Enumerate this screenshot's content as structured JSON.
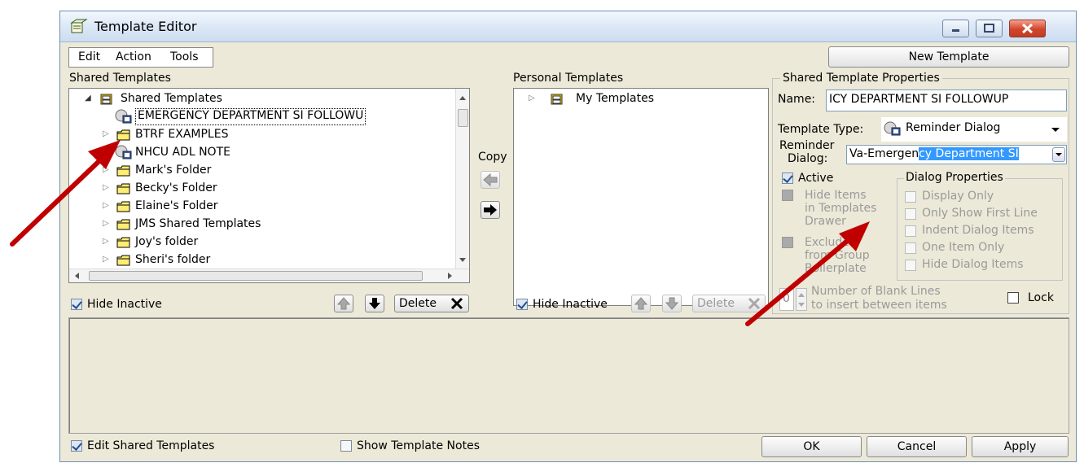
{
  "window": {
    "title": "Template Editor"
  },
  "menu": [
    {
      "label": "Edit"
    },
    {
      "label": "Action"
    },
    {
      "label": "Tools"
    }
  ],
  "new_template_label": "New Template",
  "shared": {
    "panel_label": "Shared Templates",
    "root": "Shared Templates",
    "items": [
      {
        "label": "EMERGENCY DEPARTMENT SI FOLLOWU",
        "kind": "reminder",
        "selected": true
      },
      {
        "label": "BTRF EXAMPLES",
        "kind": "folder"
      },
      {
        "label": "NHCU ADL NOTE",
        "kind": "reminder"
      },
      {
        "label": "Mark's Folder",
        "kind": "folder"
      },
      {
        "label": "Becky's Folder",
        "kind": "folder"
      },
      {
        "label": "Elaine's Folder",
        "kind": "folder"
      },
      {
        "label": "JMS Shared Templates",
        "kind": "folder"
      },
      {
        "label": "Joy's folder",
        "kind": "folder"
      },
      {
        "label": "Sheri's folder",
        "kind": "folder"
      }
    ],
    "hide_inactive_label": "Hide Inactive",
    "hide_inactive_checked": true,
    "delete_label": "Delete"
  },
  "copy_label": "Copy",
  "personal": {
    "panel_label": "Personal Templates",
    "root": "My Templates",
    "hide_inactive_label": "Hide Inactive",
    "hide_inactive_checked": true,
    "delete_label": "Delete"
  },
  "properties": {
    "group_label": "Shared Template Properties",
    "name_label": "Name:",
    "name_value": "ICY DEPARTMENT SI FOLLOWUP",
    "type_label": "Template Type:",
    "type_value": "Reminder Dialog",
    "reminder_label_1": "Reminder",
    "reminder_label_2": "Dialog:",
    "reminder_prefix": "Va-Emergen",
    "reminder_selected": "cy Department SI",
    "active_label": "Active",
    "active_checked": true,
    "hide_items_lines": [
      "Hide Items",
      "in Templates",
      "Drawer"
    ],
    "exclude_lines": [
      "Exclude",
      "from Group",
      "Boilerplate"
    ],
    "dialog_props_label": "Dialog Properties",
    "dialog_props": [
      "Display Only",
      "Only Show First Line",
      "Indent Dialog Items",
      "One Item Only",
      "Hide Dialog Items"
    ],
    "blank_lines_value": "0",
    "blank_lines_label_1": "Number of Blank Lines",
    "blank_lines_label_2": "to insert between items",
    "lock_label": "Lock"
  },
  "footer": {
    "edit_shared_label": "Edit Shared Templates",
    "edit_shared_checked": true,
    "show_notes_label": "Show Template Notes",
    "ok_label": "OK",
    "cancel_label": "Cancel",
    "apply_label": "Apply"
  },
  "colors": {
    "accent_arrow": "#c00000",
    "selection": "#3399ff",
    "window_bg": "#ece9d8"
  }
}
